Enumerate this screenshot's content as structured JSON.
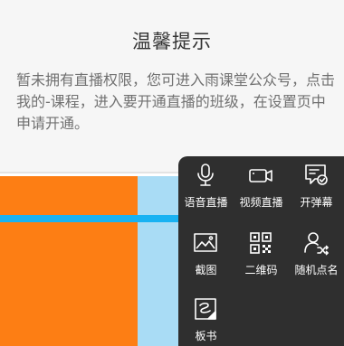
{
  "notice": {
    "title": "温馨提示",
    "message": "暂未拥有直播权限，您可进入雨课堂公众号，点击我的-课程，进入要开通直播的班级，在设置页中申请开通。"
  },
  "toolbar": {
    "items": [
      {
        "label": "语音直播",
        "icon": "microphone-icon"
      },
      {
        "label": "视频直播",
        "icon": "video-camera-icon"
      },
      {
        "label": "开弹幕",
        "icon": "bullet-comment-icon"
      },
      {
        "label": "截图",
        "icon": "screenshot-icon"
      },
      {
        "label": "二维码",
        "icon": "qr-code-icon"
      },
      {
        "label": "随机点名",
        "icon": "random-rollcall-icon"
      },
      {
        "label": "板书",
        "icon": "blackboard-icon"
      }
    ]
  },
  "colors": {
    "toolbar_bg": "#2f2f2f",
    "orange": "#fd7e14",
    "light_blue": "#a9dcf5",
    "stripe_blue": "#19b2f2"
  }
}
